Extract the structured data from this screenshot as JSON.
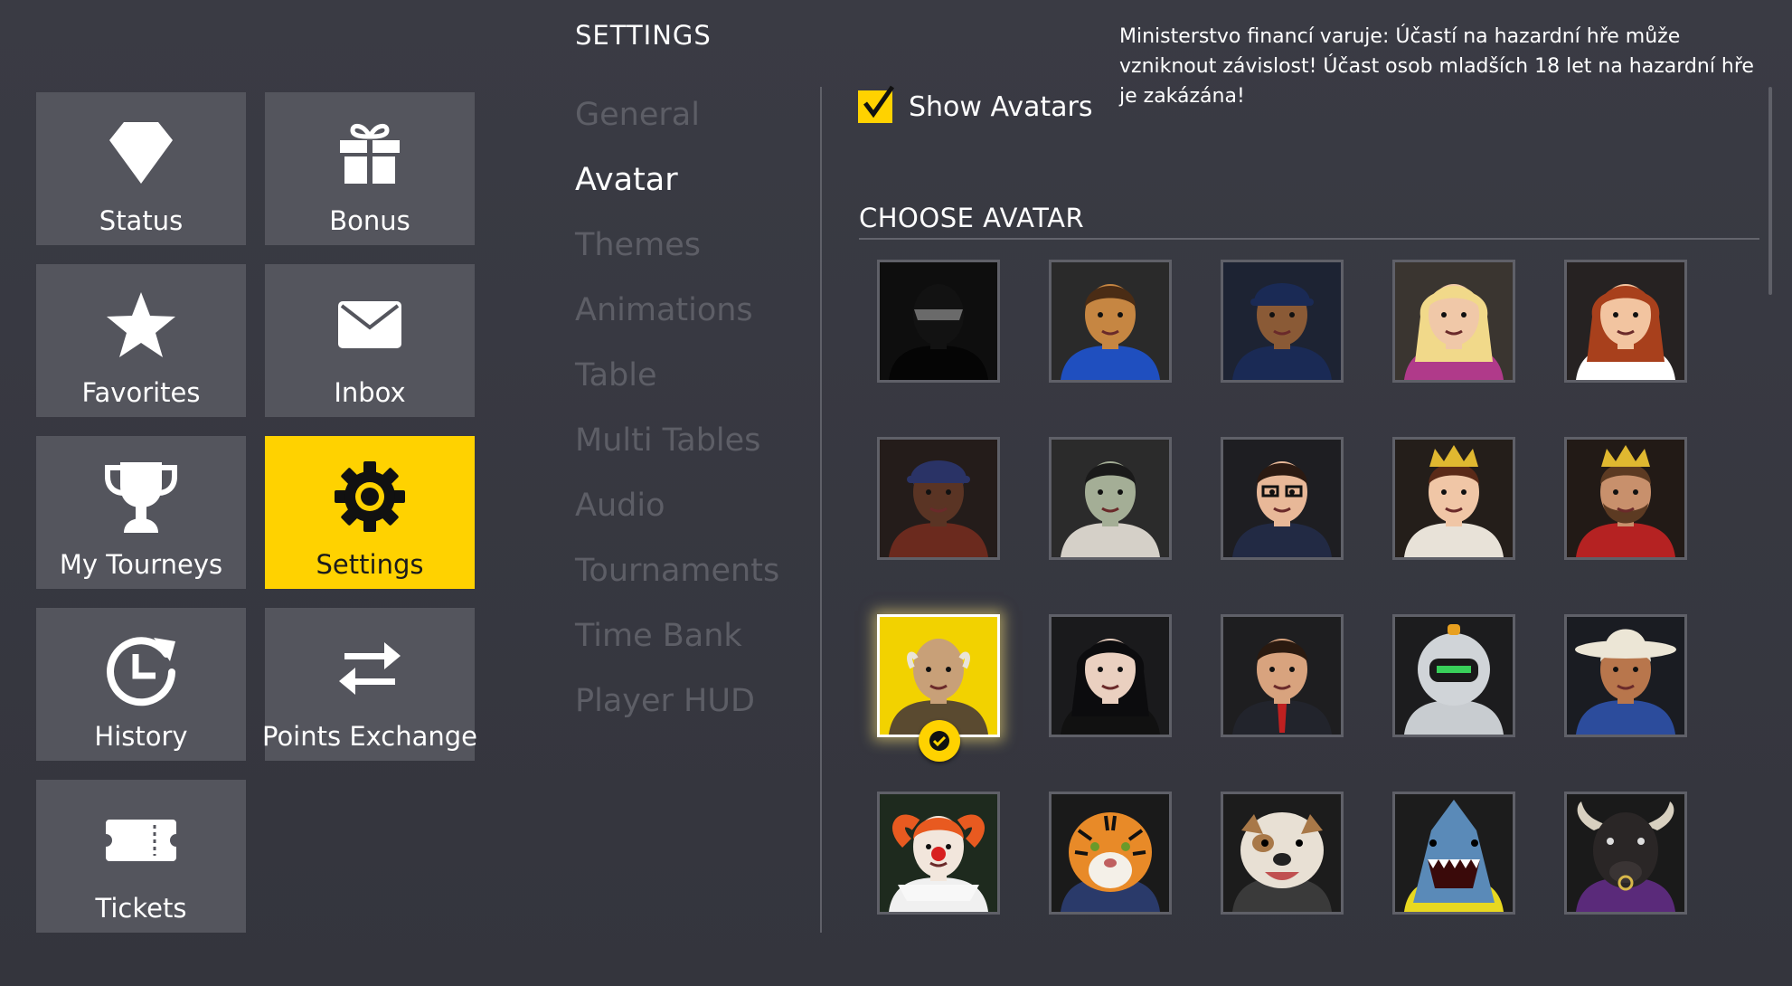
{
  "menu": {
    "tiles": [
      {
        "label": "Status",
        "icon": "diamond-icon",
        "active": false
      },
      {
        "label": "Bonus",
        "icon": "gift-icon",
        "active": false
      },
      {
        "label": "Favorites",
        "icon": "star-icon",
        "active": false
      },
      {
        "label": "Inbox",
        "icon": "envelope-icon",
        "active": false
      },
      {
        "label": "My Tourneys",
        "icon": "trophy-icon",
        "active": false
      },
      {
        "label": "Settings",
        "icon": "gear-icon",
        "active": true
      },
      {
        "label": "History",
        "icon": "history-icon",
        "active": false
      },
      {
        "label": "Points Exchange",
        "icon": "exchange-arrows-icon",
        "active": false
      },
      {
        "label": "Tickets",
        "icon": "ticket-icon",
        "active": false
      }
    ]
  },
  "settings": {
    "title": "SETTINGS",
    "nav": [
      {
        "label": "General",
        "active": false
      },
      {
        "label": "Avatar",
        "active": true
      },
      {
        "label": "Themes",
        "active": false
      },
      {
        "label": "Animations",
        "active": false
      },
      {
        "label": "Table",
        "active": false
      },
      {
        "label": "Multi Tables",
        "active": false
      },
      {
        "label": "Audio",
        "active": false
      },
      {
        "label": "Tournaments",
        "active": false
      },
      {
        "label": "Time Bank",
        "active": false
      },
      {
        "label": "Player HUD",
        "active": false
      }
    ]
  },
  "disclaimer": "Ministerstvo financí varuje: Účastí na hazardní hře může vzniknout závislost! Účast osob mladších 18 let na hazardní hře je zakázána!",
  "avatar_panel": {
    "show_avatars_label": "Show Avatars",
    "show_avatars_checked": true,
    "choose_title": "CHOOSE AVATAR",
    "selected_index": 10,
    "avatars": [
      "masked-silhouette",
      "soccer-player",
      "baseball-player",
      "blonde-woman",
      "redhead-woman",
      "rapper-cap",
      "zombie",
      "woman-glasses",
      "queen",
      "king",
      "old-man",
      "dark-hair-woman-gun",
      "businessman",
      "robot-astronaut",
      "cowboy",
      "clown",
      "tiger",
      "bulldog",
      "shark",
      "bull"
    ]
  },
  "colors": {
    "accent": "#ffd200",
    "background": "#383941",
    "tile": "#54555d",
    "nav_inactive": "#5d5e66"
  }
}
